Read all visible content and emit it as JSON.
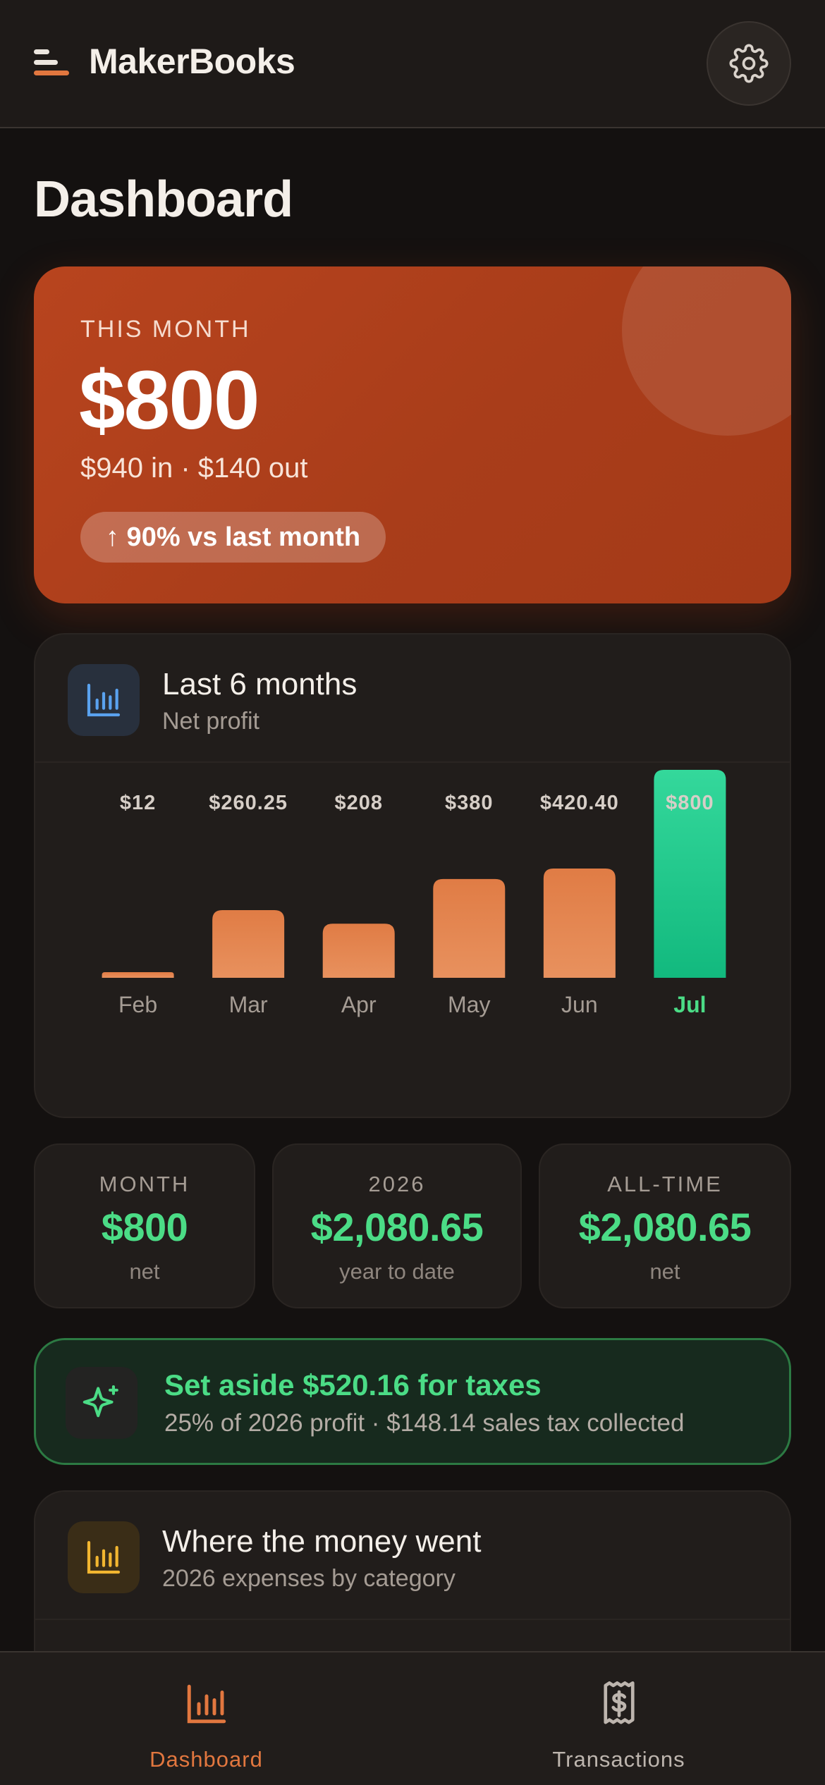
{
  "header": {
    "app_title": "MakerBooks",
    "menu_icon": "menu-icon",
    "settings_icon": "gear-icon"
  },
  "page_title": "Dashboard",
  "hero": {
    "label": "THIS MONTH",
    "amount": "$800",
    "breakdown": "$940 in · $140 out",
    "change_pill": "↑ 90% vs last month",
    "color": "#b8441e"
  },
  "chart_card": {
    "title": "Last 6 months",
    "subtitle": "Net profit",
    "icon": "bar-chart-icon"
  },
  "chart_data": {
    "type": "bar",
    "title": "Last 6 months",
    "subtitle": "Net profit",
    "categories": [
      "Feb",
      "Mar",
      "Apr",
      "May",
      "Jun",
      "Jul"
    ],
    "values": [
      12,
      260.25,
      208,
      380,
      420.4,
      800
    ],
    "data_labels": [
      "$12",
      "$260.25",
      "$208",
      "$380",
      "$420.40",
      "$800"
    ],
    "highlight_index": 5,
    "colors": {
      "bar": "#e4834f",
      "highlight": "#22c98a",
      "highlight_label": "#4bdc86"
    },
    "ylim": [
      0,
      800
    ],
    "grid": false,
    "legend": "none"
  },
  "stats": [
    {
      "label": "MONTH",
      "value": "$800",
      "note": "net"
    },
    {
      "label": "2026",
      "value": "$2,080.65",
      "note": "year to date"
    },
    {
      "label": "ALL-TIME",
      "value": "$2,080.65",
      "note": "net"
    }
  ],
  "tax_banner": {
    "title": "Set aside $520.16 for taxes",
    "subtitle": "25% of 2026 profit · $148.14 sales tax collected",
    "icon": "sparkle-icon",
    "color": "#4bdc86"
  },
  "expenses_card": {
    "title": "Where the money went",
    "subtitle": "2026 expenses by category",
    "icon": "bar-chart-icon"
  },
  "bottom_nav": {
    "items": [
      {
        "label": "Dashboard",
        "icon": "bar-chart-icon",
        "active": true
      },
      {
        "label": "Transactions",
        "icon": "receipt-dollar-icon",
        "active": false
      }
    ],
    "active_color": "#e2773f",
    "inactive_color": "#bdb5ae"
  }
}
